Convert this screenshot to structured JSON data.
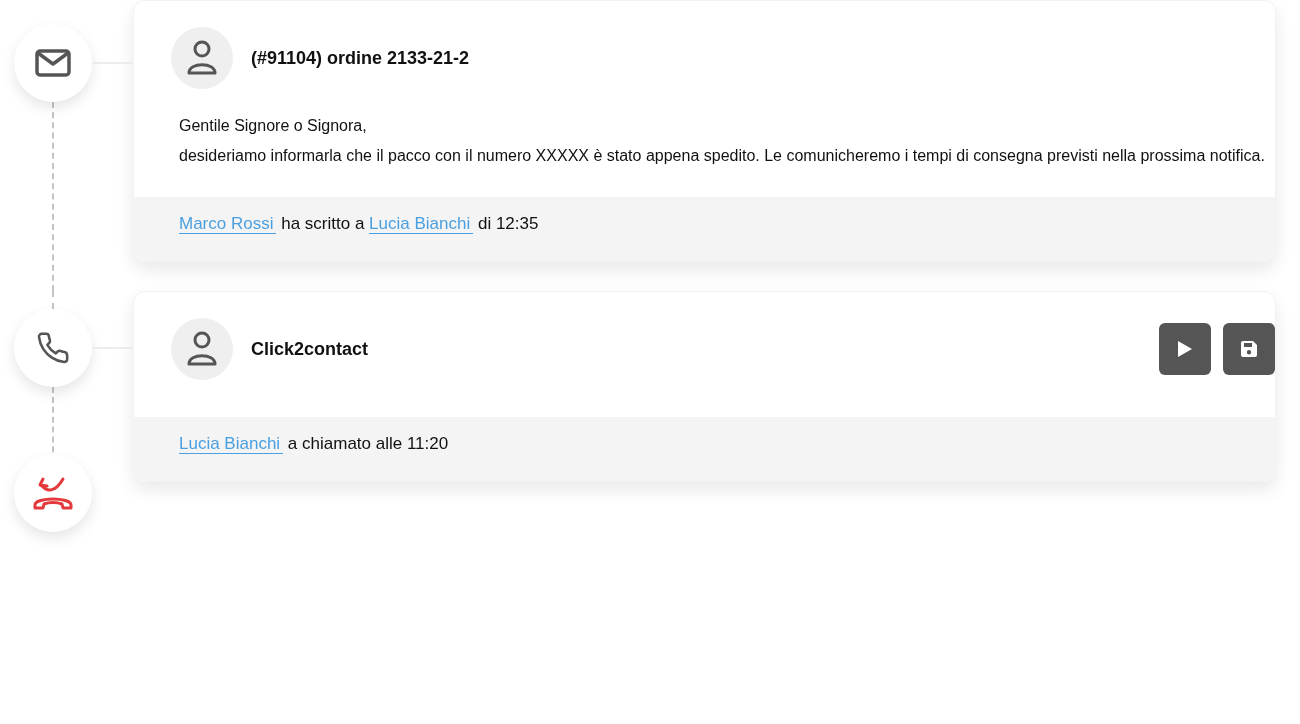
{
  "timeline": [
    {
      "kind": "email",
      "card": {
        "title": "(#91104) ordine 2133-21-2",
        "body": [
          "Gentile Signore o Signora,",
          "desideriamo informarla che il pacco con il numero XXXXX è stato appena spedito. Le comunicheremo i tempi di consegna previsti nella prossima notifica."
        ],
        "footer": [
          {
            "kind": "link",
            "text": "Marco Rossi"
          },
          {
            "kind": "text",
            "text": "ha scritto a"
          },
          {
            "kind": "link",
            "text": "Lucia Bianchi"
          },
          {
            "kind": "text",
            "text": "di 12:35"
          }
        ]
      }
    },
    {
      "kind": "call",
      "card": {
        "title": "Click2contact",
        "actions": [
          {
            "kind": "play"
          },
          {
            "kind": "save"
          }
        ],
        "footer": [
          {
            "kind": "link",
            "text": "Lucia Bianchi"
          },
          {
            "kind": "text",
            "text": "a chiamato alle 11:20"
          }
        ]
      }
    },
    {
      "kind": "missed_call"
    }
  ]
}
